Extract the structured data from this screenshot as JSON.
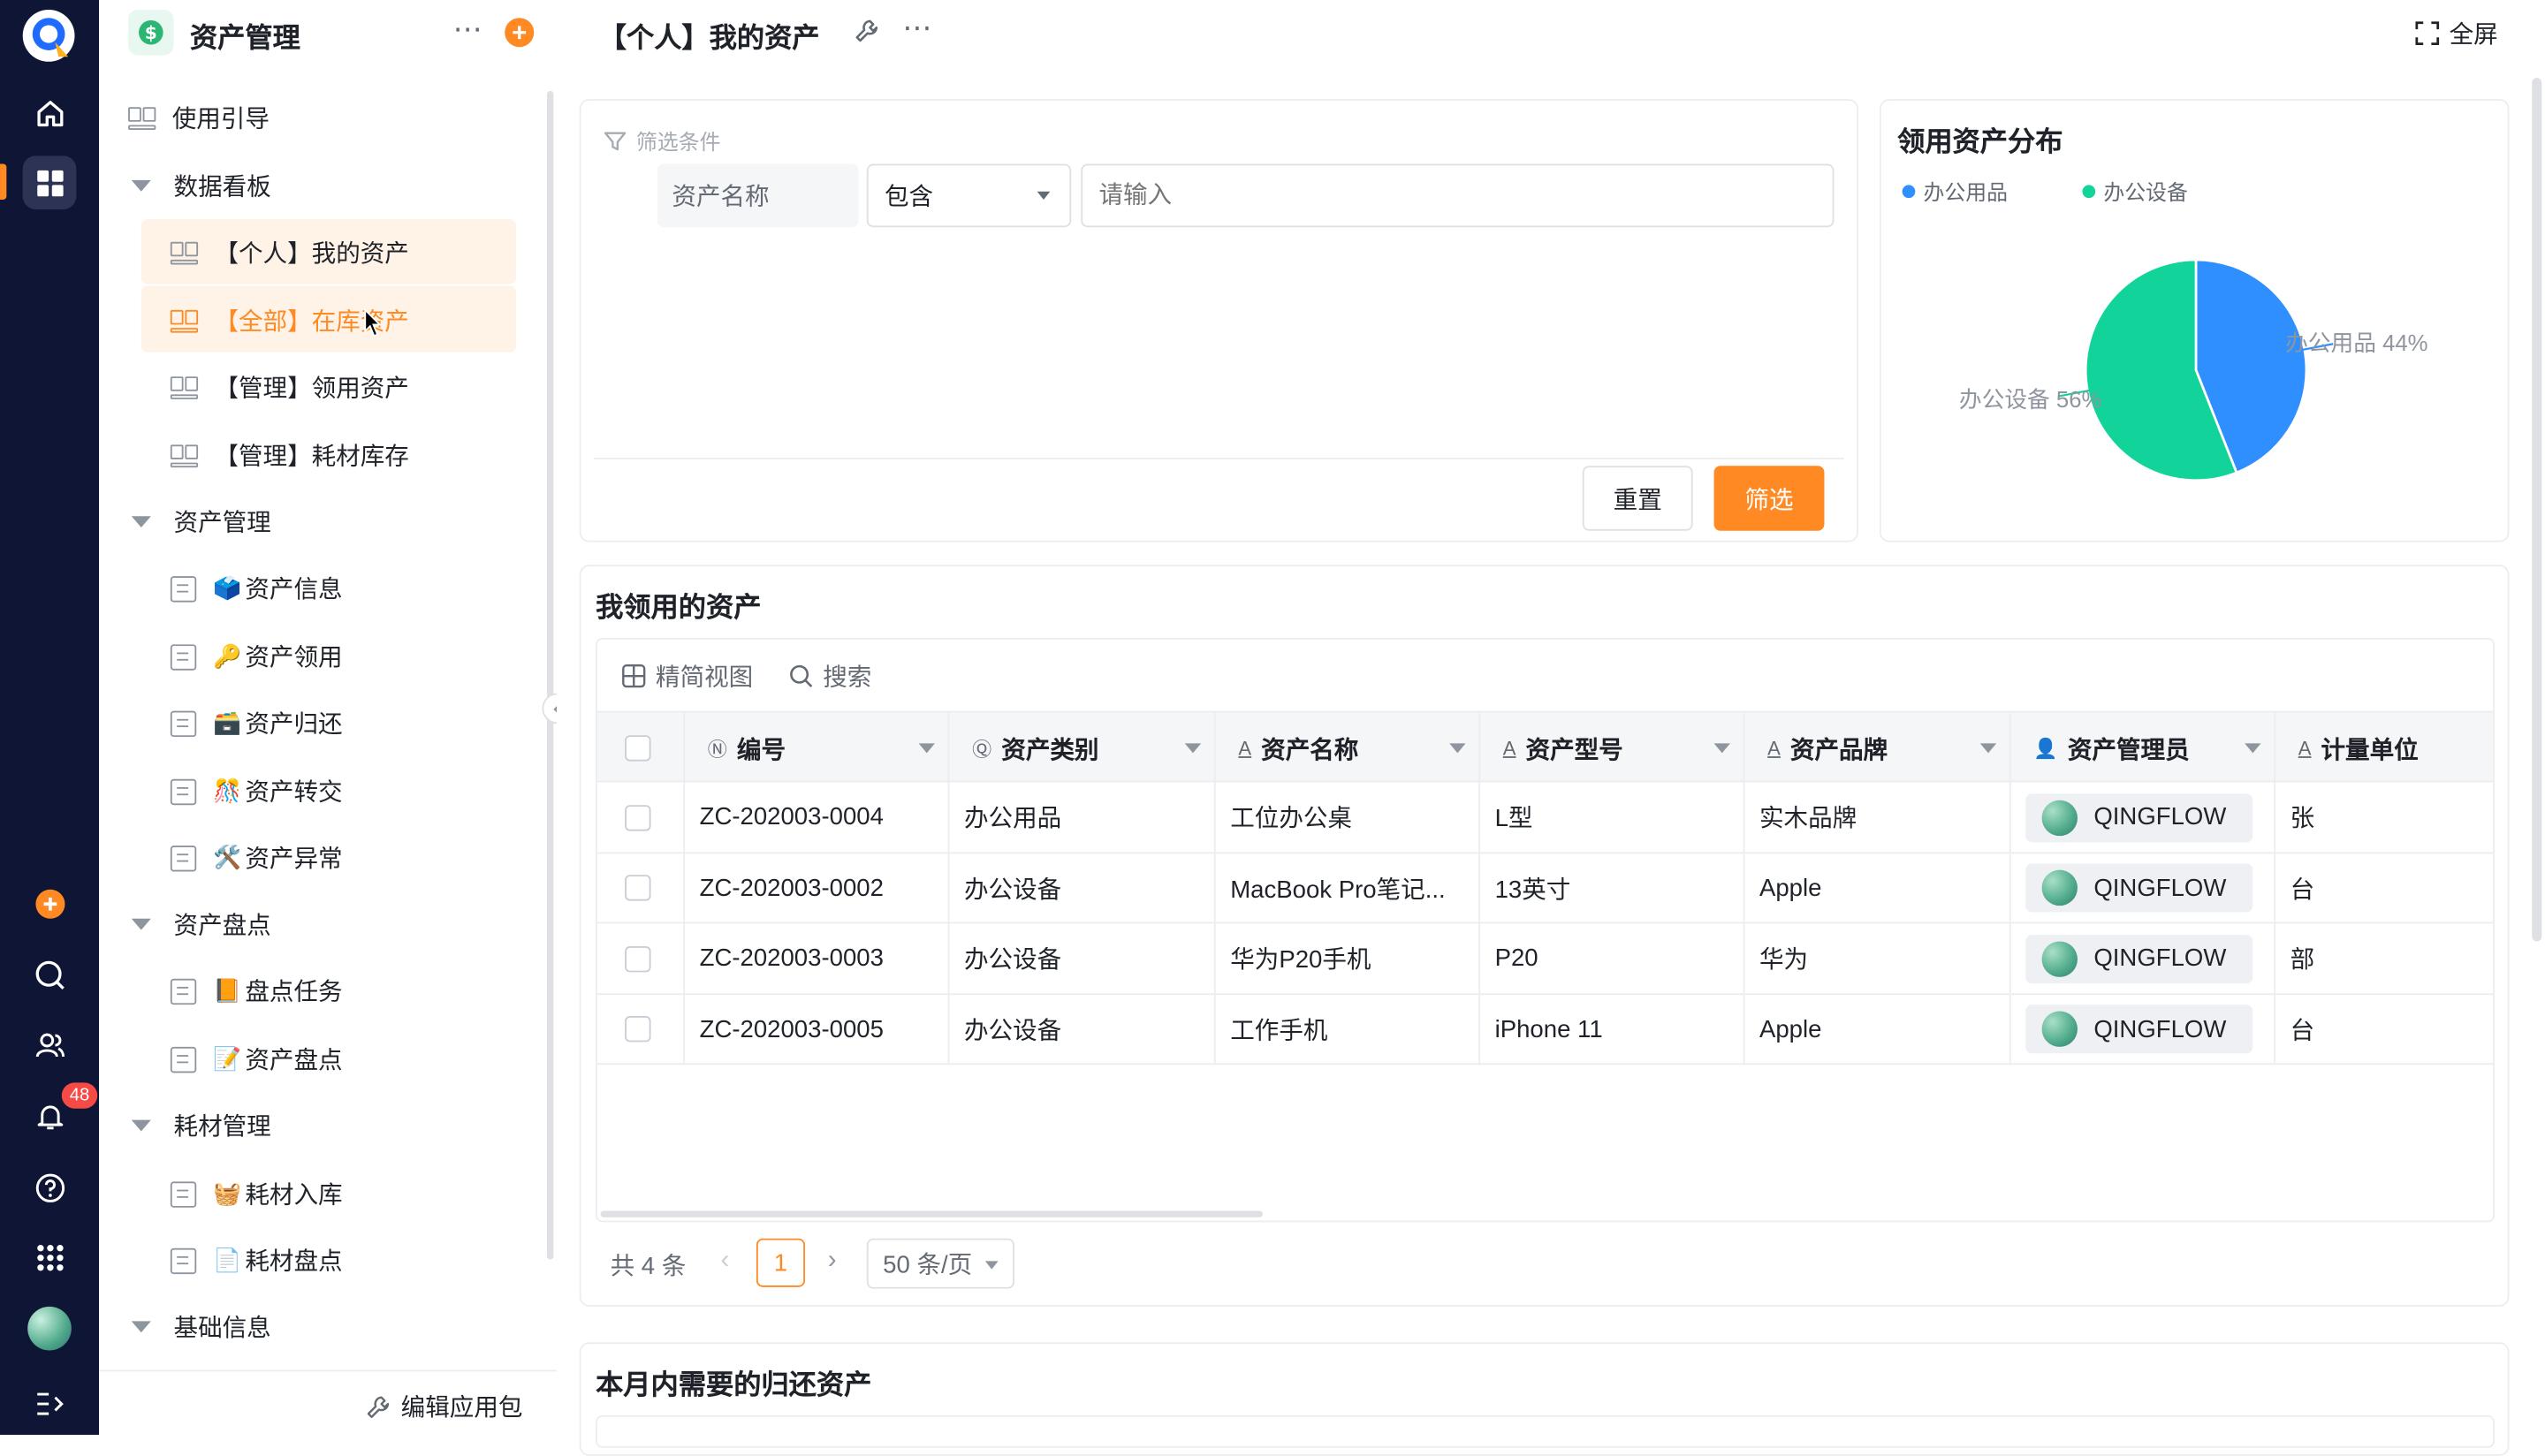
{
  "sidebar": {
    "app_title": "资产管理",
    "edit_label": "编辑应用包",
    "items": [
      {
        "label": "使用引导"
      },
      {
        "label": "数据看板"
      },
      {
        "label": "【个人】我的资产"
      },
      {
        "label": "【全部】在库资产"
      },
      {
        "label": "【管理】领用资产"
      },
      {
        "label": "【管理】耗材库存"
      },
      {
        "label": "资产管理"
      },
      {
        "label": "资产信息",
        "emoji": "🗳️"
      },
      {
        "label": "资产领用",
        "emoji": "🔑"
      },
      {
        "label": "资产归还",
        "emoji": "🗃️"
      },
      {
        "label": "资产转交",
        "emoji": "🎊"
      },
      {
        "label": "资产异常",
        "emoji": "🛠️"
      },
      {
        "label": "资产盘点"
      },
      {
        "label": "盘点任务",
        "emoji": "📙"
      },
      {
        "label": "资产盘点",
        "emoji": "📝"
      },
      {
        "label": "耗材管理"
      },
      {
        "label": "耗材入库",
        "emoji": "🧺"
      },
      {
        "label": "耗材盘点",
        "emoji": "📄"
      },
      {
        "label": "基础信息"
      }
    ]
  },
  "rail": {
    "notification_badge": "48"
  },
  "header": {
    "title": "【个人】我的资产",
    "fullscreen_label": "全屏"
  },
  "filter": {
    "section_label": "筛选条件",
    "field_label": "资产名称",
    "operator": "包含",
    "value_placeholder": "请输入",
    "reset_label": "重置",
    "apply_label": "筛选"
  },
  "pie_card": {
    "title": "领用资产分布",
    "legend": [
      "办公用品",
      "办公设备"
    ],
    "label_office_supplies": "办公用品 44%",
    "label_office_equipment": "办公设备 56%"
  },
  "chart_data": {
    "type": "pie",
    "title": "领用资产分布",
    "categories": [
      "办公用品",
      "办公设备"
    ],
    "values": [
      44,
      56
    ],
    "colors": [
      "#2f8fff",
      "#12d49a"
    ],
    "legend": "top-left"
  },
  "table_card": {
    "title": "我领用的资产",
    "view_label": "精简视图",
    "search_label": "搜索",
    "columns": [
      "编号",
      "资产类别",
      "资产名称",
      "资产型号",
      "资产品牌",
      "资产管理员",
      "计量单位"
    ],
    "rows": [
      [
        "ZC-202003-0004",
        "办公用品",
        "工位办公桌",
        "L型",
        "实木品牌",
        "QINGFLOW",
        "张"
      ],
      [
        "ZC-202003-0002",
        "办公设备",
        "MacBook Pro笔记...",
        "13英寸",
        "Apple",
        "QINGFLOW",
        "台"
      ],
      [
        "ZC-202003-0003",
        "办公设备",
        "华为P20手机",
        "P20",
        "华为",
        "QINGFLOW",
        "部"
      ],
      [
        "ZC-202003-0005",
        "办公设备",
        "工作手机",
        "iPhone 11",
        "Apple",
        "QINGFLOW",
        "台"
      ]
    ],
    "total_label": "共 4 条",
    "current_page": "1",
    "page_size": "50 条/页"
  },
  "return_card": {
    "title": "本月内需要的归还资产"
  },
  "colors": {
    "accent": "#ff8a24",
    "rail": "#0f1535",
    "selected_bg": "#fff3e8"
  }
}
